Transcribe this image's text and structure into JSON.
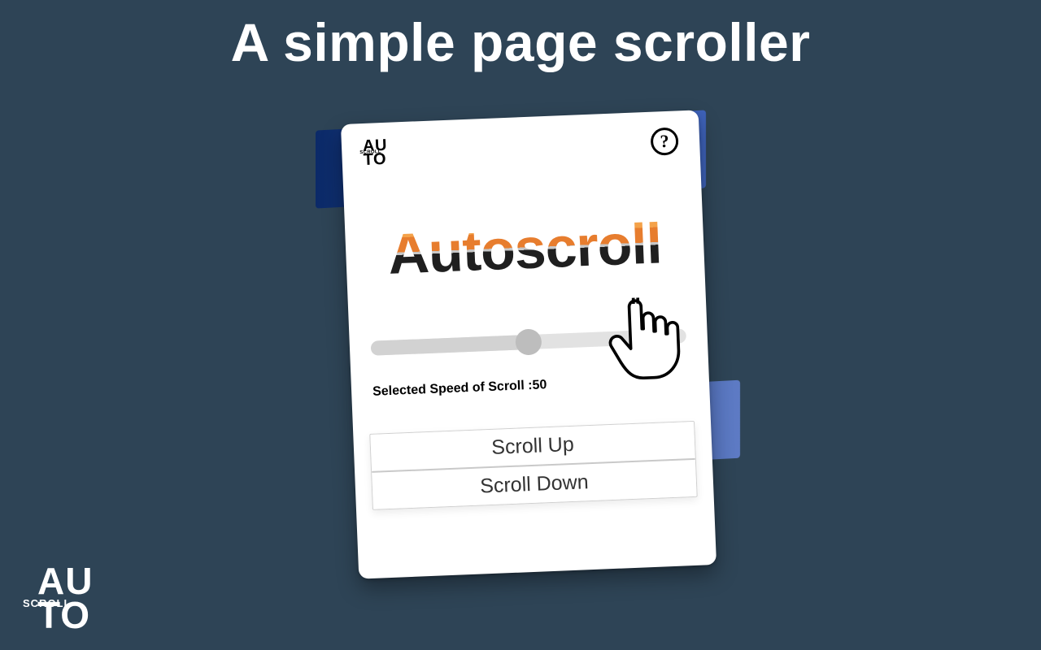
{
  "headline": "A simple page scroller",
  "logo": {
    "line1": "AU",
    "line2": "TO",
    "mid": "SCROLL"
  },
  "card": {
    "title": "Autoscroll",
    "help_symbol": "?",
    "speed_label_prefix": "Selected Speed of Scroll :",
    "speed_value": "50",
    "slider_percent": 50,
    "buttons": {
      "up": "Scroll Up",
      "down": "Scroll Down"
    }
  }
}
